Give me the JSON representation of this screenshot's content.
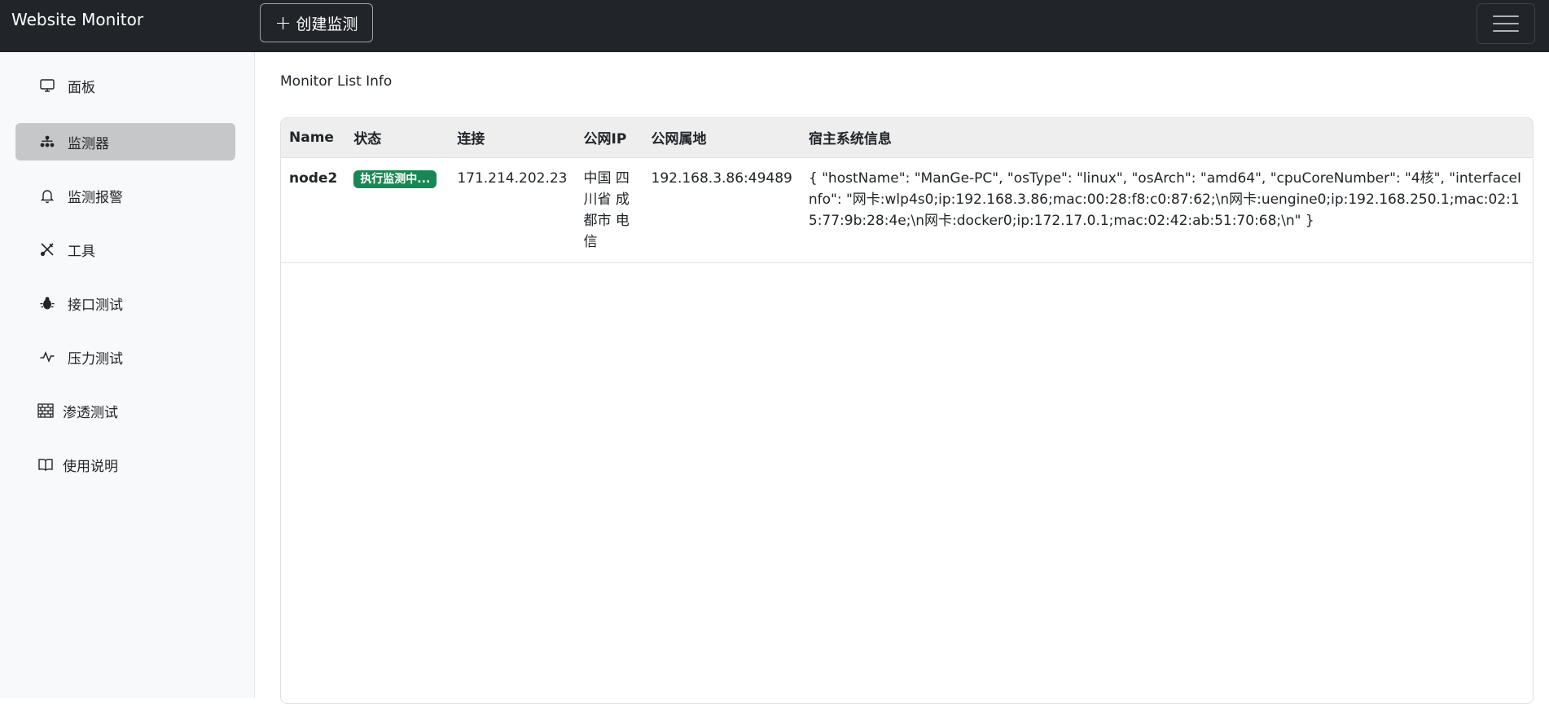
{
  "navbar": {
    "brand": "Website Monitor",
    "create_button_icon": "plus-icon",
    "create_button_label": "创建监测",
    "menu_toggle_icon": "hamburger-menu-icon"
  },
  "sidebar": {
    "items": [
      {
        "label": "面板",
        "icon": "monitor-icon"
      },
      {
        "label": "监测器",
        "icon": "diagram-icon",
        "active": true
      },
      {
        "label": "监测报警",
        "icon": "bell-icon"
      },
      {
        "label": "工具",
        "icon": "tools-icon"
      },
      {
        "label": "接口测试",
        "icon": "bug-icon"
      },
      {
        "label": "压力测试",
        "icon": "activity-icon"
      },
      {
        "label": "渗透测试",
        "icon": "bricks-icon"
      },
      {
        "label": "使用说明",
        "icon": "book-icon"
      }
    ]
  },
  "main": {
    "title": "Monitor List Info",
    "table": {
      "headers": [
        "Name",
        "状态",
        "连接",
        "公网IP",
        "公网属地",
        "宿主系统信息"
      ],
      "rows": [
        {
          "name": "node2",
          "status": "执行监测中...",
          "connection": "171.214.202.23",
          "public_ip": "中国 四川省 成都市 电信",
          "location": "192.168.3.86:49489",
          "system_info": "{ \"hostName\": \"ManGe-PC\", \"osType\": \"linux\", \"osArch\": \"amd64\", \"cpuCoreNumber\": \"4核\", \"interfaceInfo\": \"网卡:wlp4s0;ip:192.168.3.86;mac:00:28:f8:c0:87:62;\\n网卡:uengine0;ip:192.168.250.1;mac:02:15:77:9b:28:4e;\\n网卡:docker0;ip:172.17.0.1;mac:02:42:ab:51:70:68;\\n\" }"
        }
      ]
    }
  },
  "colors": {
    "navbar_bg": "#212529",
    "sidebar_bg": "#f8f9fa",
    "active_item_bg": "#c6c7c8",
    "status_badge_bg": "#198754"
  }
}
